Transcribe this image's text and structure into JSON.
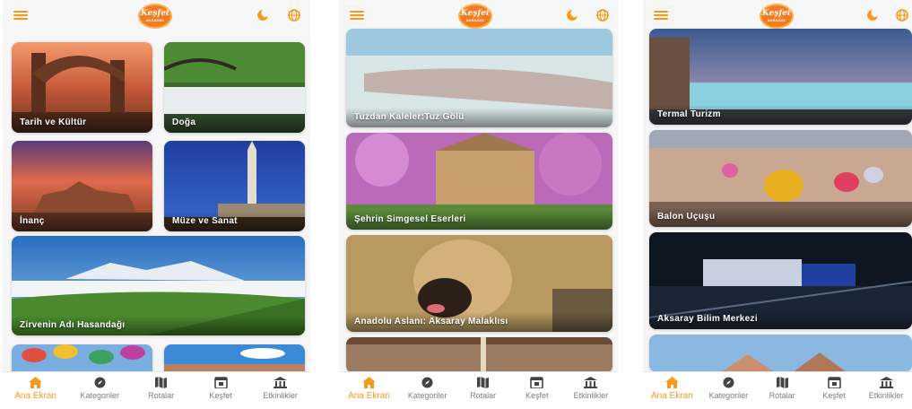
{
  "colors": {
    "accent": "#f59a1c",
    "logo_bg": "#f47c20",
    "nav_text": "#7d7d7d"
  },
  "logo": {
    "line1": "Keşfet",
    "line2": "AKSARAY"
  },
  "screens": [
    {
      "header": {
        "menu_icon": "menu-icon",
        "theme_icon": "moon-icon",
        "language_icon": "globe-icon"
      },
      "cards": [
        {
          "label": "Tarih ve Kültür"
        },
        {
          "label": "Doğa"
        },
        {
          "label": "İnanç"
        },
        {
          "label": "Müze ve Sanat"
        },
        {
          "label": "Zirvenin Adı Hasandağı"
        },
        {
          "label": ""
        },
        {
          "label": ""
        }
      ]
    },
    {
      "cards": [
        {
          "label": "Tuzdan Kaleler:Tuz Gölü"
        },
        {
          "label": "Şehrin Simgesel Eserleri"
        },
        {
          "label": "Anadolu Aslanı: Aksaray Malaklısı"
        },
        {
          "label": ""
        }
      ]
    },
    {
      "cards": [
        {
          "label": "Termal Turizm"
        },
        {
          "label": "Balon Uçuşu"
        },
        {
          "label": "Aksaray Bilim Merkezi"
        },
        {
          "label": ""
        }
      ]
    }
  ],
  "nav": {
    "active": "Ana Ekran",
    "items": [
      "Ana Ekran",
      "Kategoriler",
      "Rotalar",
      "Keşfet",
      "Etkinlikler"
    ],
    "icons": [
      "home-icon",
      "compass-icon",
      "map-icon",
      "calendar-icon",
      "museum-icon"
    ]
  }
}
